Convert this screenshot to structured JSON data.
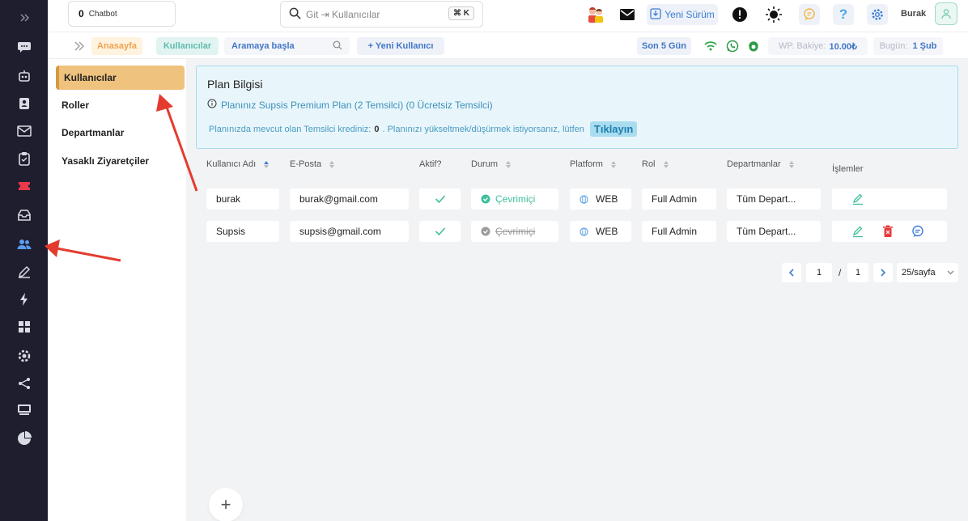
{
  "topbar": {
    "chatbot_count": "0",
    "chatbot_label": "Chatbot",
    "search_placeholder": "Git ⇥ Kullanıcılar",
    "search_shortcut": "⌘ K",
    "new_version_label": "Yeni Sürüm",
    "username": "Burak"
  },
  "subbar": {
    "home": "Anasayfa",
    "users": "Kullanıcılar",
    "search_start": "Aramaya başla",
    "new_user": "+ Yeni Kullanıcı",
    "days": "Son 5 Gün",
    "wp_balance_label": "WP. Bakiye:",
    "wp_balance_value": "10.00₺",
    "today_label": "Bugün:",
    "today_value": "1 Şub"
  },
  "submenu": {
    "items": [
      "Kullanıcılar",
      "Roller",
      "Departmanlar",
      "Yasaklı Ziyaretçiler"
    ]
  },
  "plan": {
    "title": "Plan Bilgisi",
    "info": "Planınız Supsis Premium Plan (2 Temsilci) (0 Ücretsiz Temsilci)",
    "credit_prefix": "Planınızda mevcut olan Temsilci krediniz:",
    "credit_value": "0",
    "credit_suffix": ". Planınızı yükseltmek/düşürmek istiyorsanız, lütfen",
    "link": "Tıklayın"
  },
  "table": {
    "headers": [
      "Kullanıcı Adı",
      "E-Posta",
      "Aktif?",
      "Durum",
      "Platform",
      "Rol",
      "Departmanlar",
      "İşlemler"
    ],
    "rows": [
      {
        "name": "burak",
        "email": "burak@gmail.com",
        "status": "Çevrimiçi",
        "platform": "WEB",
        "role": "Full Admin",
        "departments": "Tüm Depart..."
      },
      {
        "name": "Supsis",
        "email": "supsis@gmail.com",
        "status": "Çevrimiçi",
        "platform": "WEB",
        "role": "Full Admin",
        "departments": "Tüm Depart..."
      }
    ]
  },
  "pagination": {
    "current": "1",
    "separator": "/",
    "total": "1",
    "per_page": "25/sayfa"
  },
  "colors": {
    "rail": "#1e1e2e",
    "active_menu": "#efc27d",
    "accent_blue": "#3d7dd8",
    "online_green": "#3fbf9c",
    "arrow_red": "#e53b2f"
  }
}
